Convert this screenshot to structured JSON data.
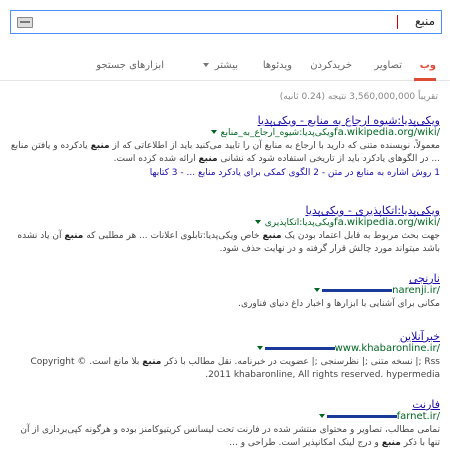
{
  "search": {
    "query": "منبع"
  },
  "tabs": [
    {
      "label": "وب",
      "active": true
    },
    {
      "label": "تصاویر",
      "active": false
    },
    {
      "label": "خریدکردن",
      "active": false
    },
    {
      "label": "ویدئوها",
      "active": false
    },
    {
      "label": "بیشتر",
      "active": false
    },
    {
      "label": "ابزارهای جستجو",
      "active": false
    }
  ],
  "stats": "تقریباً 3,560,000,000 نتیجه (0.24 ثانیه)",
  "results": [
    {
      "title": "ویکی‌پدیا:شیوه ارجاع به منابع - ویکی‌پدیا",
      "url": "fa.wikipedia.org/wiki/",
      "crumb": "ویکی‌پدیا:شیوه_ارجاع_به_منابع",
      "snippet": "معمولاً، نویسنده متنی که دارید با ارجاع به منابع آن را تایید می‌کنید باید از اطلاعاتی که از منبع یادکرده و یافتن منابع ... در الگوهای یادکرد باید از تاریخی استفاده شود که نشانی منبع ارائه شده کرده است.",
      "links": "1 روش اشاره به منابع در متن - 2 الگوی کمکی برای یادکرد منابع ... - 3 کتابها"
    },
    {
      "title": "ویکی‌پدیا:اتکاپذیری - ویکی‌پدیا",
      "url": "fa.wikipedia.org/wiki/",
      "crumb": "ویکی‌پدیا:اتکاپذیری",
      "snippet": "جهت بحث مربوط به قابل اعتماد بودن یک منبع خاص ویکی‌پدیا:تابلوی اعلانات ... هر مطلبی که منبع آن یاد نشده باشد میتواند مورد چالش قرار گرفته و در نهایت حذف شود."
    },
    {
      "title": "نارنجی",
      "url": "narenji.ir/",
      "snippet": "مکانی برای آشنایی با ابزارها و اخبار داغ دنیای فناوری."
    },
    {
      "title": "خبرآنلاین",
      "url": "www.khabaronline.ir/",
      "snippet": "Rss ;| نسخه متنی ;| نظرسنجی ;| عضویت در خبرنامه. نقل مطالب با ذکر منبع بلا مانع است. © Copyright 2011 khabaronline, All rights reserved. hypermedia."
    },
    {
      "title": "فارنت",
      "url": "farnet.ir/",
      "snippet": "تمامی مطالب، تصاویر و محتوای منتشر شده در فارنت تحت لیسانس کریتیوکامنز بوده و هرگونه کپی‌برداری از آن تنها با ذکر منبع و درج لینک امکانپذیر است. طراحی و ..."
    }
  ]
}
